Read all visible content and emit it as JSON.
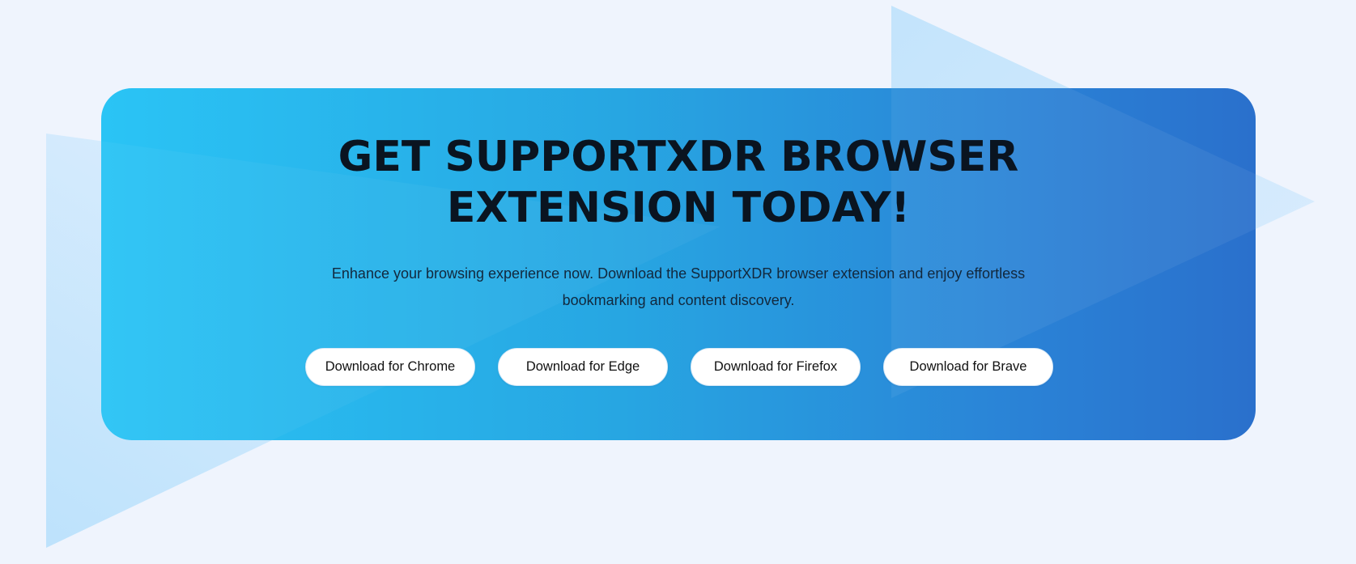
{
  "cta": {
    "title_line1": "GET SUPPORTXDR BROWSER",
    "title_line2": "EXTENSION TODAY!",
    "subtitle_line1": "Enhance your browsing experience now. Download the SupportXDR browser extension and enjoy effortless",
    "subtitle_line2": "bookmarking and content discovery.",
    "buttons": [
      {
        "label": "Download for Chrome"
      },
      {
        "label": "Download for Edge"
      },
      {
        "label": "Download for Firefox"
      },
      {
        "label": "Download for Brave"
      }
    ]
  },
  "colors": {
    "page_background": "#eff4fd",
    "card_gradient_start": "#2ac4f5",
    "card_gradient_end": "#2a70cc",
    "decor_triangle": "#bfe2fb",
    "title_text": "#0a1420",
    "button_background": "#ffffff"
  },
  "decor": {
    "shapes": [
      "play-triangle",
      "play-triangle"
    ]
  }
}
